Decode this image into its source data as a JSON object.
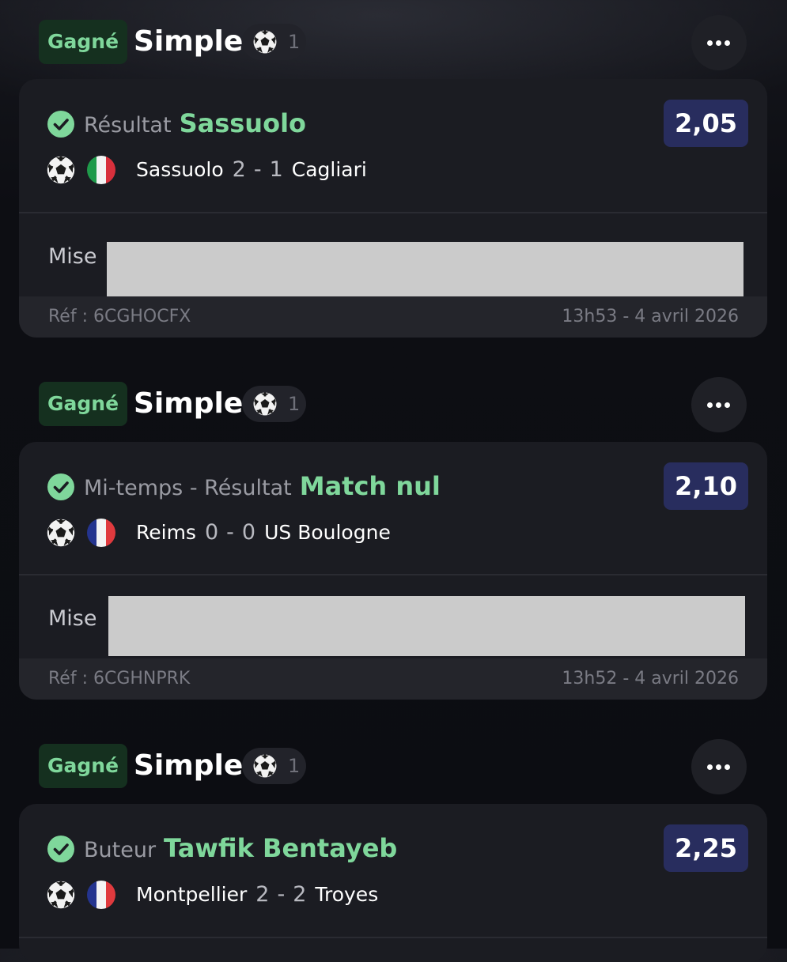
{
  "bets": [
    {
      "status": "Gagné",
      "type": "Simple",
      "selection_count": "1",
      "market": "Résultat",
      "pick": "Sassuolo",
      "odds": "2,05",
      "sport_icon": "football-icon",
      "flag_icon": "italy-flag-icon",
      "flag_colors": [
        "#1f9a4a",
        "#f4f4f4",
        "#d8303c"
      ],
      "home_team": "Sassuolo",
      "home_score": "2",
      "away_score": "1",
      "away_team": "Cagliari",
      "score_separator": "-",
      "stake_label": "Mise",
      "reference": "Réf : 6CGHOCFX",
      "datetime": "13h53 - 4 avril 2026"
    },
    {
      "status": "Gagné",
      "type": "Simple",
      "selection_count": "1",
      "market": "Mi-temps - Résultat",
      "pick": "Match nul",
      "odds": "2,10",
      "sport_icon": "football-icon",
      "flag_icon": "france-flag-icon",
      "flag_colors": [
        "#24348f",
        "#f4f4f4",
        "#e03a3e"
      ],
      "home_team": "Reims",
      "home_score": "0",
      "away_score": "0",
      "away_team": "US Boulogne",
      "score_separator": "-",
      "stake_label": "Mise",
      "reference": "Réf : 6CGHNPRK",
      "datetime": "13h52 - 4 avril 2026"
    },
    {
      "status": "Gagné",
      "type": "Simple",
      "selection_count": "1",
      "market": "Buteur",
      "pick": "Tawfik Bentayeb",
      "odds": "2,25",
      "sport_icon": "football-icon",
      "flag_icon": "france-flag-icon",
      "flag_colors": [
        "#24348f",
        "#f4f4f4",
        "#e03a3e"
      ],
      "home_team": "Montpellier",
      "home_score": "2",
      "away_score": "2",
      "away_team": "Troyes",
      "score_separator": "-"
    }
  ],
  "colors": {
    "won_badge_bg": "#15301f",
    "won_text": "#7fd79b",
    "odds_bg": "#282d5e",
    "card_bg": "#1b1c22",
    "footer_bg": "#24252b",
    "redacted_box": "#cbcbcb"
  }
}
